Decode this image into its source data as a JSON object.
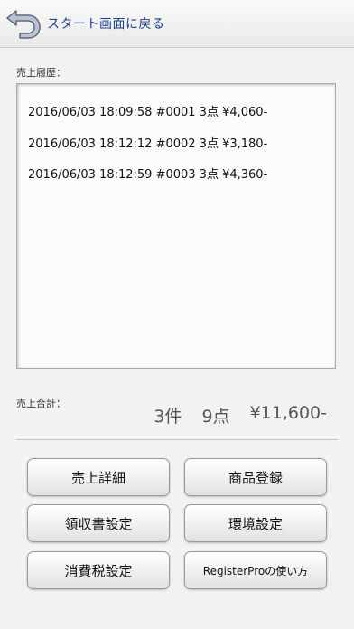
{
  "header": {
    "back_label": "スタート画面に戻る"
  },
  "history": {
    "label": "売上履歴：",
    "rows": [
      "2016/06/03 18:09:58 #0001  3点 ¥4,060-",
      "2016/06/03 18:12:12 #0002  3点 ¥3,180-",
      "2016/06/03 18:12:59 #0003  3点 ¥4,360-"
    ]
  },
  "summary": {
    "label": "売上合計：",
    "count": "3件",
    "items": "9点",
    "amount": "¥11,600-"
  },
  "buttons": {
    "sales_detail": "売上詳細",
    "product_register": "商品登録",
    "receipt_settings": "領収書設定",
    "environment_settings": "環境設定",
    "tax_settings": "消費税設定",
    "how_to_use": "RegisterProの使い方"
  },
  "colors": {
    "accent": "#1d3f8a",
    "background": "#f2f2f2"
  },
  "icons": {
    "back": "back-arrow-icon"
  }
}
